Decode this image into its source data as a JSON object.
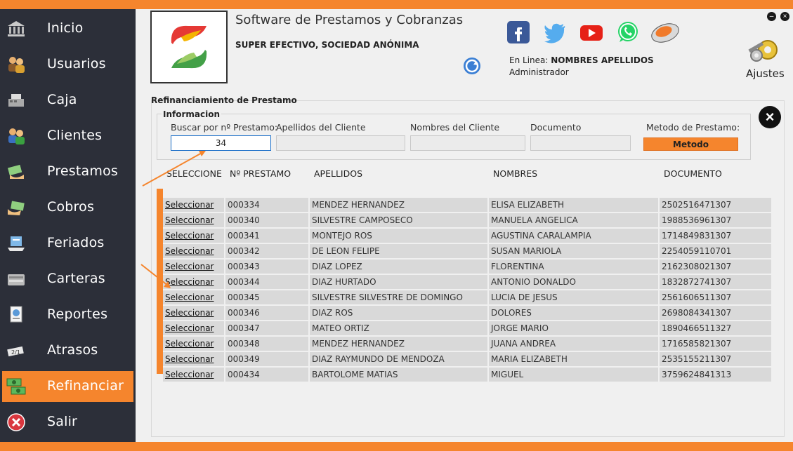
{
  "colors": {
    "accent": "#f5852d",
    "sidebar": "#2c2f39"
  },
  "sidebar": {
    "items": [
      {
        "label": "Inicio",
        "icon": "bank-icon"
      },
      {
        "label": "Usuarios",
        "icon": "users-icon"
      },
      {
        "label": "Caja",
        "icon": "cash-register-icon"
      },
      {
        "label": "Clientes",
        "icon": "clients-icon"
      },
      {
        "label": "Prestamos",
        "icon": "loan-icon"
      },
      {
        "label": "Cobros",
        "icon": "payment-icon"
      },
      {
        "label": "Feriados",
        "icon": "holiday-icon"
      },
      {
        "label": "Carteras",
        "icon": "wallet-icon"
      },
      {
        "label": "Reportes",
        "icon": "report-icon"
      },
      {
        "label": "Atrasos",
        "icon": "overdue-icon"
      },
      {
        "label": "Refinanciar",
        "icon": "refinance-icon",
        "active": true
      },
      {
        "label": "Salir",
        "icon": "exit-icon"
      }
    ]
  },
  "header": {
    "app_title": "Software de Prestamos y Cobranzas",
    "company": "SUPER EFECTIVO, SOCIEDAD ANÓNIMA",
    "online_prefix": "En Linea:",
    "online_user": "NOMBRES APELLIDOS",
    "role": "Administrador",
    "settings_label": "Ajustes",
    "social_icons": [
      "facebook-icon",
      "twitter-icon",
      "youtube-icon",
      "whatsapp-icon",
      "mouse-icon"
    ]
  },
  "form": {
    "section_title": "Refinanciamiento de Prestamo",
    "info_title": "Informacion",
    "loan_search_label": "Buscar por nº Prestamo:",
    "loan_search_value": "34",
    "surnames_label": "Apellidos del Cliente",
    "names_label": "Nombres del Cliente",
    "document_label": "Documento",
    "method_label": "Metodo de Prestamo:",
    "method_button": "Metodo"
  },
  "table": {
    "headers": [
      "SELECCIONE",
      "Nº PRESTAMO",
      "APELLIDOS",
      "NOMBRES",
      "DOCUMENTO"
    ],
    "rows": [
      {
        "action": "Seleccionar",
        "loan": "000334",
        "surnames": "MENDEZ HERNANDEZ",
        "names": "ELISA ELIZABETH",
        "document": "2502516471307"
      },
      {
        "action": "Seleccionar",
        "loan": "000340",
        "surnames": "SILVESTRE CAMPOSECO",
        "names": "MANUELA ANGELICA",
        "document": "1988536961307"
      },
      {
        "action": "Seleccionar",
        "loan": "000341",
        "surnames": "MONTEJO ROS",
        "names": "AGUSTINA CARALAMPIA",
        "document": "1714849831307"
      },
      {
        "action": "Seleccionar",
        "loan": "000342",
        "surnames": "DE LEON FELIPE",
        "names": "SUSAN MARIOLA",
        "document": "2254059110701"
      },
      {
        "action": "Seleccionar",
        "loan": "000343",
        "surnames": "DIAZ LOPEZ",
        "names": "FLORENTINA",
        "document": "2162308021307"
      },
      {
        "action": "Seleccionar",
        "loan": "000344",
        "surnames": "DIAZ HURTADO",
        "names": "ANTONIO DONALDO",
        "document": "1832872741307"
      },
      {
        "action": "Seleccionar",
        "loan": "000345",
        "surnames": "SILVESTRE SILVESTRE DE DOMINGO",
        "names": "LUCIA DE JESUS",
        "document": "2561606511307"
      },
      {
        "action": "Seleccionar",
        "loan": "000346",
        "surnames": "DIAZ ROS",
        "names": "DOLORES",
        "document": "2698084341307"
      },
      {
        "action": "Seleccionar",
        "loan": "000347",
        "surnames": "MATEO ORTIZ",
        "names": "JORGE MARIO",
        "document": "1890466511327"
      },
      {
        "action": "Seleccionar",
        "loan": "000348",
        "surnames": "MENDEZ HERNANDEZ",
        "names": "JUANA ANDREA",
        "document": "1716585821307"
      },
      {
        "action": "Seleccionar",
        "loan": "000349",
        "surnames": "DIAZ RAYMUNDO DE MENDOZA",
        "names": "MARIA ELIZABETH",
        "document": "2535155211307"
      },
      {
        "action": "Seleccionar",
        "loan": "000434",
        "surnames": "BARTOLOME MATIAS",
        "names": "MIGUEL",
        "document": "3759624841313"
      }
    ]
  }
}
